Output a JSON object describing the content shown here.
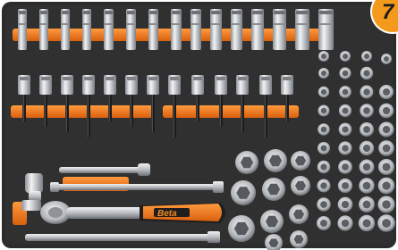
{
  "photo": {
    "tool_brand": "Beta",
    "badge_text": "7",
    "colors": {
      "foam": "#2c2c2c",
      "holder": "#e8711a",
      "handle": "#ef7a16",
      "chrome": "#c9ccd0",
      "badge": "#f39a1c"
    }
  }
}
